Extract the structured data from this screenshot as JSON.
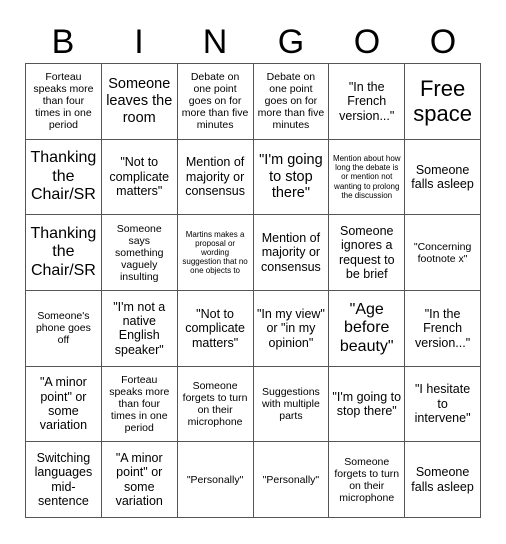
{
  "header": {
    "letters": [
      "B",
      "I",
      "N",
      "G",
      "O",
      "O"
    ]
  },
  "cells": [
    {
      "text": "Forteau speaks more than four times in one period",
      "size": "s"
    },
    {
      "text": "Someone leaves the room",
      "size": "l"
    },
    {
      "text": "Debate on one point goes on for more than five minutes",
      "size": "s"
    },
    {
      "text": "Debate on one point goes on for more than five minutes",
      "size": "s"
    },
    {
      "text": "\"In the French version...\"",
      "size": "m"
    },
    {
      "text": "Free space",
      "size": "xxl"
    },
    {
      "text": "Thanking the Chair/SR",
      "size": "xl"
    },
    {
      "text": "\"Not to complicate matters\"",
      "size": "m"
    },
    {
      "text": "Mention of majority or consensus",
      "size": "m"
    },
    {
      "text": "\"I'm going to stop there\"",
      "size": "l"
    },
    {
      "text": "Mention about how long the debate is or mention not wanting to prolong the discussion",
      "size": "xs"
    },
    {
      "text": "Someone falls asleep",
      "size": "m"
    },
    {
      "text": "Thanking the Chair/SR",
      "size": "xl"
    },
    {
      "text": "Someone says something vaguely insulting",
      "size": "s"
    },
    {
      "text": "Martins makes a proposal or wording suggestion that no one objects to",
      "size": "xs"
    },
    {
      "text": "Mention of majority or consensus",
      "size": "m"
    },
    {
      "text": "Someone ignores a request to be brief",
      "size": "m"
    },
    {
      "text": "\"Concerning footnote x\"",
      "size": "s"
    },
    {
      "text": "Someone's phone goes off",
      "size": "s"
    },
    {
      "text": "\"I'm not a native English speaker\"",
      "size": "m"
    },
    {
      "text": "\"Not to complicate matters\"",
      "size": "m"
    },
    {
      "text": "\"In my view\" or \"in my opinion\"",
      "size": "m"
    },
    {
      "text": "\"Age before beauty\"",
      "size": "xl"
    },
    {
      "text": "\"In the French version...\"",
      "size": "m"
    },
    {
      "text": "\"A minor point\" or some variation",
      "size": "m"
    },
    {
      "text": "Forteau speaks more than four times in one period",
      "size": "s"
    },
    {
      "text": "Someone forgets to turn on their microphone",
      "size": "s"
    },
    {
      "text": "Suggestions with multiple parts",
      "size": "s"
    },
    {
      "text": "\"I'm going to stop there\"",
      "size": "m"
    },
    {
      "text": "\"I hesitate to intervene\"",
      "size": "m"
    },
    {
      "text": "Switching languages mid-sentence",
      "size": "m"
    },
    {
      "text": "\"A minor point\" or some variation",
      "size": "m"
    },
    {
      "text": "\"Personally\"",
      "size": "s"
    },
    {
      "text": "\"Personally\"",
      "size": "s"
    },
    {
      "text": "Someone forgets to turn on their microphone",
      "size": "s"
    },
    {
      "text": "Someone falls asleep",
      "size": "m"
    }
  ]
}
